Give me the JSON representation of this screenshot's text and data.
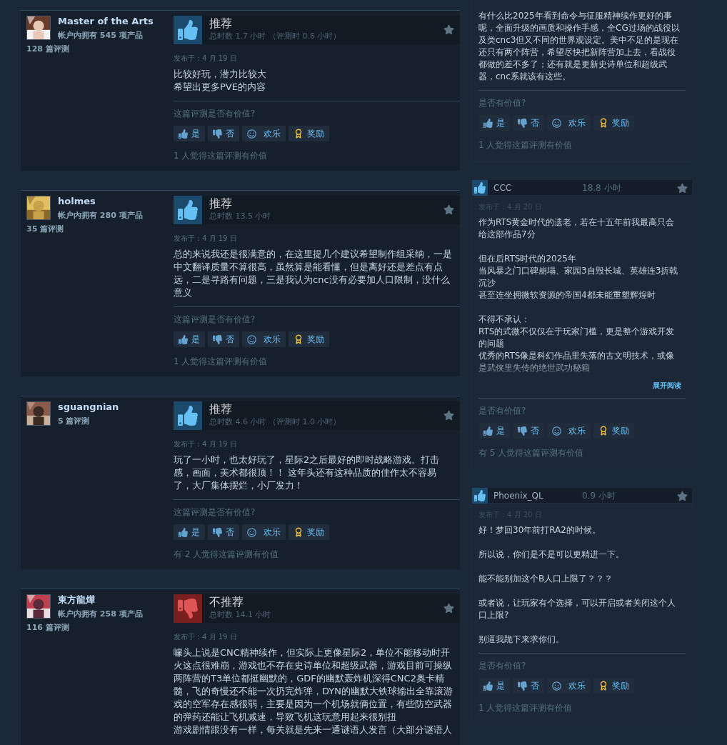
{
  "left_reviews": [
    {
      "author": {
        "name": "Master of the Arts",
        "products": "帐户内拥有 545 项产品",
        "reviews": "128 篇评测"
      },
      "recommended": true,
      "verdict": "推荐",
      "playtime": "总时数 1.7 小时 （评测时 0.6 小时）",
      "date": "发布于：4 月 19 日",
      "paragraphs": [
        [
          "比较好玩，潜力比较大",
          "希望出更多PVE的内容"
        ]
      ],
      "helpful_prompt": "这篇评测是否有价值?",
      "buttons": [
        {
          "kind": "yes",
          "label": "是"
        },
        {
          "kind": "no",
          "label": "否"
        },
        {
          "kind": "funny",
          "label": "欢乐"
        },
        {
          "kind": "award",
          "label": "奖励"
        }
      ],
      "helpful_count": "1 人觉得这篇评测有价值"
    },
    {
      "author": {
        "name": "holmes",
        "products": "帐户内拥有 280 项产品",
        "reviews": "35 篇评测"
      },
      "recommended": true,
      "verdict": "推荐",
      "playtime": "总时数 13.5 小时",
      "date": "发布于：4 月 19 日",
      "paragraphs": [
        [
          "总的来说我还是很满意的，在这里提几个建议希望制作组采纳，一是中文翻译质量不算很高，虽然算是能看懂，但是离好还是差点有点远，二是寻路有问题，三是我认为cnc没有必要加人口限制，没什么意义"
        ]
      ],
      "helpful_prompt": "这篇评测是否有价值?",
      "buttons": [
        {
          "kind": "yes",
          "label": "是"
        },
        {
          "kind": "no",
          "label": "否"
        },
        {
          "kind": "funny",
          "label": "欢乐"
        },
        {
          "kind": "award",
          "label": "奖励"
        }
      ],
      "helpful_count": "1 人觉得这篇评测有价值"
    },
    {
      "author": {
        "name": "sguangnian",
        "reviews": "5 篇评测"
      },
      "recommended": true,
      "verdict": "推荐",
      "playtime": "总时数 4.6 小时 （评测时 1.0 小时）",
      "date": "发布于：4 月 19 日",
      "paragraphs": [
        [
          "玩了一小时，也太好玩了，星际2之后最好的即时战略游戏。打击感，画面，美术都很顶！！ 这年头还有这种品质的佳作太不容易了，大厂集体摆烂，小厂发力！"
        ]
      ],
      "helpful_prompt": "这篇评测是否有价值?",
      "buttons": [
        {
          "kind": "yes",
          "label": "是"
        },
        {
          "kind": "no",
          "label": "否"
        },
        {
          "kind": "funny",
          "label": "欢乐"
        },
        {
          "kind": "award",
          "label": "奖励"
        }
      ],
      "helpful_count": "有 2 人觉得这篇评测有价值"
    },
    {
      "author": {
        "name": "東方龍燁",
        "products": "帐户内拥有 258 项产品",
        "reviews": "116 篇评测"
      },
      "recommended": false,
      "verdict": "不推荐",
      "playtime": "总时数 14.1 小时",
      "date": "发布于：4 月 19 日",
      "paragraphs": [
        [
          "噱头上说是CNC精神续作，但实际上更像星际2，单位不能移动时开火这点很难崩，游戏也不存在史诗单位和超级武器，游戏目前可操纵两阵营的T3单位都挺幽默的，GDF的幽默轰炸机深得CNC2奥卡精髓，飞的奇慢还不能一次扔完炸弹，DYN的幽默大铁球输出全靠滚游戏的空军存在感很弱，主要是因为一个机场就俩位置，有些防空武器的弹药还能让飞机减速，导致飞机这玩意用起来很别扭",
          "游戏剧情跟没有一样，每关就是先来一通谜语人发言（大部分谜语人"
        ]
      ]
    }
  ],
  "right_reviews": [
    {
      "paragraphs": [
        [
          "有什么比2025年看到命令与征服精神续作更好的事呢，全面升级的画质和操作手感，全CG过场的战役以及类cnc3但又不同的世界观设定。美中不足的是现在还只有两个阵营，希望尽快把新阵营加上去，看战役都做的差不多了；还有就是更新史诗单位和超级武器，cnc系就该有这些。"
        ]
      ],
      "helpful_prompt": "是否有价值?",
      "buttons": [
        {
          "kind": "yes",
          "label": "是"
        },
        {
          "kind": "no",
          "label": "否"
        },
        {
          "kind": "funny",
          "label": "欢乐"
        },
        {
          "kind": "award",
          "label": "奖励"
        }
      ],
      "helpful_count": "1 人觉得这篇评测有价值"
    },
    {
      "recommended": true,
      "author": "CCC",
      "hours": "18.8 小时",
      "date": "发布于：4 月 20 日",
      "paragraphs": [
        [
          "作为RTS黄金时代的遗老，若在十五年前我最高只会给这部作品7分"
        ],
        [
          "但在后RTS时代的2025年",
          "当风暴之门口碑崩塌、家园3自毁长城、英雄连3折戟沉沙",
          "甚至连坐拥微软资源的帝国4都未能重塑辉煌时"
        ],
        [
          "不得不承认：",
          "RTS的式微不仅仅在于玩家门槛，更是整个游戏开发的问题",
          "优秀的RTS像是科幻作品里失落的古文明技术，或像是武侠里失传的绝世武功秘籍"
        ]
      ],
      "collapsed": true,
      "expand_link": "展开阅读",
      "helpful_prompt": "是否有价值?",
      "buttons": [
        {
          "kind": "yes",
          "label": "是"
        },
        {
          "kind": "no",
          "label": "否"
        },
        {
          "kind": "funny",
          "label": "欢乐"
        },
        {
          "kind": "award",
          "label": "奖励"
        }
      ],
      "helpful_count": "有 5 人觉得这篇评测有价值"
    },
    {
      "recommended": true,
      "author": "Phoenix_QL",
      "hours": "0.9 小时",
      "date": "发布于：4 月 20 日",
      "paragraphs": [
        [
          "好！梦回30年前打RA2的时候。"
        ],
        [
          "所以说，你们是不是可以更精进一下。"
        ],
        [
          "能不能别加这个B人口上限了？？？"
        ],
        [
          "或者说，让玩家有个选择，可以开启或者关闭这个人口上限?"
        ],
        [
          "别逼我跪下来求你们。"
        ]
      ],
      "helpful_prompt": "是否有价值?",
      "buttons": [
        {
          "kind": "yes",
          "label": "是"
        },
        {
          "kind": "no",
          "label": "否"
        },
        {
          "kind": "funny",
          "label": "欢乐"
        },
        {
          "kind": "award",
          "label": "奖励"
        }
      ],
      "helpful_count": "1 人觉得这篇评测有价值"
    }
  ]
}
